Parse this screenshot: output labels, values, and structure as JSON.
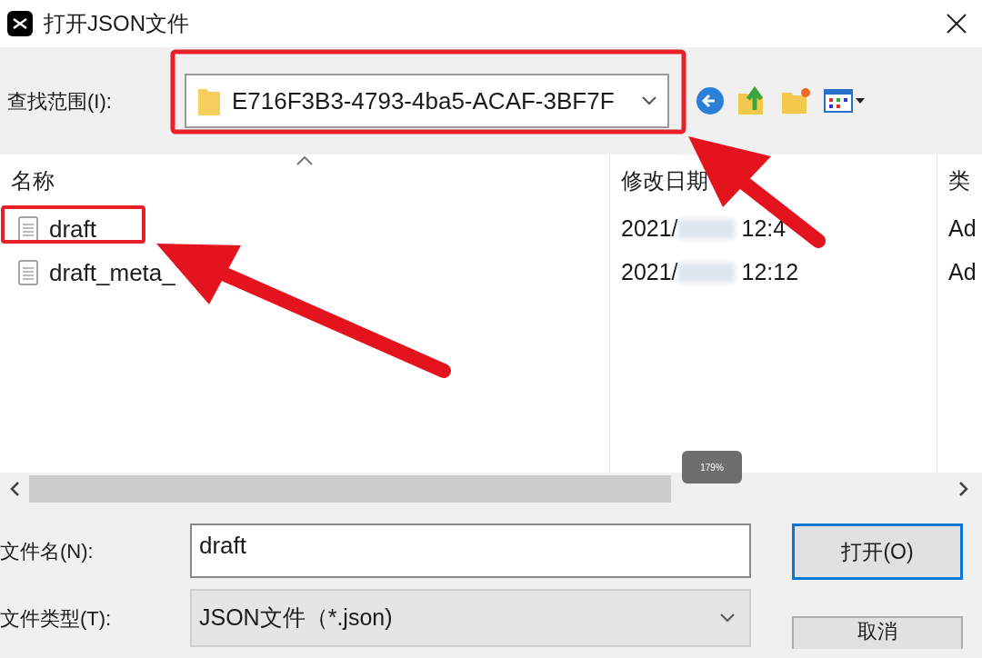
{
  "window": {
    "title": "打开JSON文件"
  },
  "look_in": {
    "label": "查找范围(I):",
    "value": "E716F3B3-4793-4ba5-ACAF-3BF7F"
  },
  "columns": [
    "名称",
    "修改日期",
    "类"
  ],
  "rows": [
    {
      "name": "draft",
      "date": "2021/",
      "time": "12:4",
      "type": "Ad"
    },
    {
      "name": "draft_meta_",
      "date": "2021/",
      "time": "12:12",
      "type": "Ad"
    }
  ],
  "zoom_badge": "179%",
  "file_name": {
    "label": "文件名(N):",
    "value": "draft"
  },
  "file_type": {
    "label": "文件类型(T):",
    "value": "JSON文件（*.json)"
  },
  "buttons": [
    "打开(O)",
    "取消"
  ]
}
